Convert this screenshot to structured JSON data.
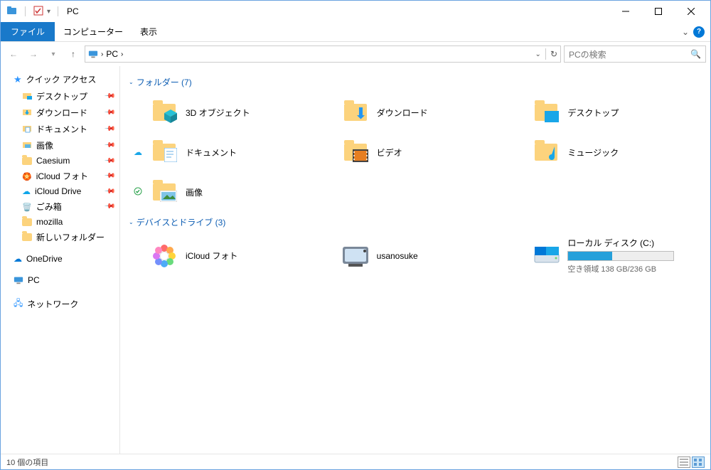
{
  "window": {
    "title": "PC"
  },
  "ribbon": {
    "file": "ファイル",
    "tabs": [
      "コンピューター",
      "表示"
    ]
  },
  "nav": {
    "address_root": "PC",
    "search_placeholder": "PCの検索"
  },
  "sidebar": {
    "quick_access": {
      "label": "クイック アクセス",
      "items": [
        {
          "label": "デスクトップ",
          "icon": "desktop",
          "pinned": true
        },
        {
          "label": "ダウンロード",
          "icon": "download",
          "pinned": true
        },
        {
          "label": "ドキュメント",
          "icon": "document",
          "pinned": true
        },
        {
          "label": "画像",
          "icon": "pictures",
          "pinned": true
        },
        {
          "label": "Caesium",
          "icon": "folder",
          "pinned": true
        },
        {
          "label": "iCloud フォト",
          "icon": "icloud-photo",
          "pinned": true
        },
        {
          "label": "iCloud Drive",
          "icon": "icloud-drive",
          "pinned": true
        },
        {
          "label": "ごみ箱",
          "icon": "trash",
          "pinned": true
        },
        {
          "label": "mozilla",
          "icon": "folder",
          "pinned": false
        },
        {
          "label": "新しいフォルダー",
          "icon": "folder",
          "pinned": false
        }
      ]
    },
    "onedrive": {
      "label": "OneDrive"
    },
    "pc": {
      "label": "PC"
    },
    "network": {
      "label": "ネットワーク"
    }
  },
  "content": {
    "folders": {
      "header": "フォルダー (7)",
      "items": [
        {
          "label": "3D オブジェクト",
          "icon": "3d",
          "sync": ""
        },
        {
          "label": "ダウンロード",
          "icon": "download",
          "sync": ""
        },
        {
          "label": "デスクトップ",
          "icon": "desktop",
          "sync": ""
        },
        {
          "label": "ドキュメント",
          "icon": "document",
          "sync": "cloud"
        },
        {
          "label": "ビデオ",
          "icon": "video",
          "sync": ""
        },
        {
          "label": "ミュージック",
          "icon": "music",
          "sync": ""
        },
        {
          "label": "画像",
          "icon": "pictures",
          "sync": "check"
        }
      ]
    },
    "drives": {
      "header": "デバイスとドライブ (3)",
      "items": [
        {
          "label": "iCloud フォト",
          "icon": "icloud-photo",
          "type": "device"
        },
        {
          "label": "usanosuke",
          "icon": "camera",
          "type": "device"
        },
        {
          "label": "ローカル ディスク (C:)",
          "icon": "disk",
          "type": "disk",
          "free_label": "空き領域 138 GB/236 GB",
          "fill_pct": 42
        }
      ]
    }
  },
  "status": {
    "count_label": "10 個の項目"
  }
}
